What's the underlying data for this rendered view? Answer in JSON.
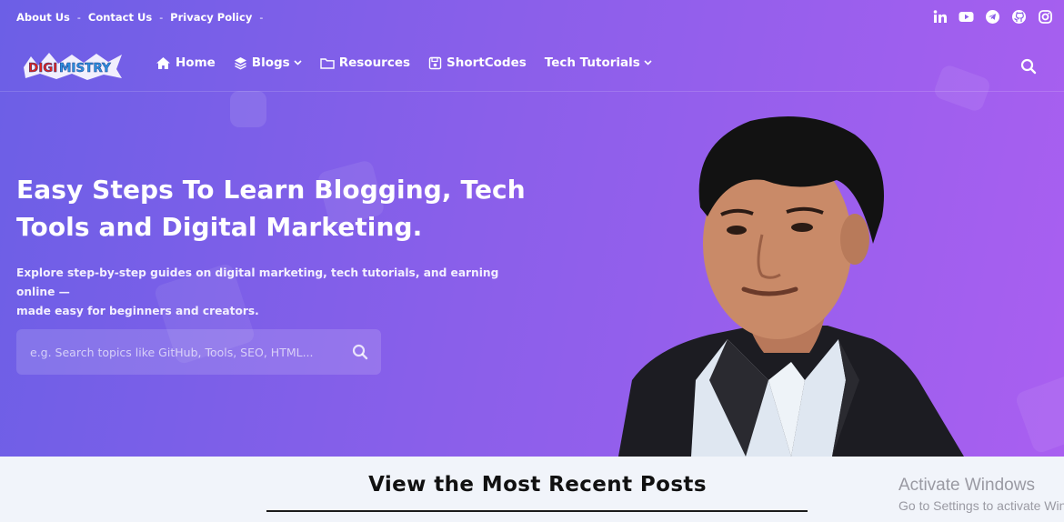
{
  "topbar": {
    "links": [
      "About Us",
      "Contact Us",
      "Privacy Policy"
    ],
    "socials": [
      "linkedin-icon",
      "youtube-icon",
      "telegram-icon",
      "github-icon",
      "instagram-icon"
    ]
  },
  "nav": {
    "logo_text": "DIGIMISTRY",
    "items": [
      {
        "label": "Home",
        "icon": "home-icon"
      },
      {
        "label": "Blogs",
        "icon": "layers-icon",
        "dropdown": true
      },
      {
        "label": "Resources",
        "icon": "folder-icon"
      },
      {
        "label": "ShortCodes",
        "icon": "save-icon"
      },
      {
        "label": "Tech Tutorials",
        "dropdown": true
      }
    ]
  },
  "hero": {
    "headline_line1": "Easy Steps To Learn Blogging, Tech",
    "headline_line2": "Tools and Digital Marketing.",
    "subtext_line1": "Explore step-by-step guides on digital marketing, tech tutorials, and earning online —",
    "subtext_line2": "made easy for beginners and creators.",
    "search_placeholder": "e.g. Search topics like GitHub, Tools, SEO, HTML..."
  },
  "recent": {
    "title": "View the Most Recent Posts"
  },
  "watermark": {
    "line1": "Activate Windows",
    "line2": "Go to Settings to activate Windows."
  },
  "colors": {
    "gradient_start": "#6c5fe6",
    "gradient_end": "#a95ff0",
    "section_bg": "#f1f4fa"
  }
}
